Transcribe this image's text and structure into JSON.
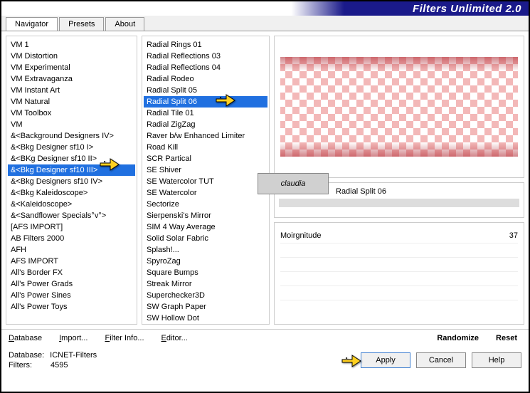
{
  "app_title": "Filters Unlimited 2.0",
  "tabs": [
    "Navigator",
    "Presets",
    "About"
  ],
  "active_tab": 0,
  "left_list": [
    "VM 1",
    "VM Distortion",
    "VM Experimental",
    "VM Extravaganza",
    "VM Instant Art",
    "VM Natural",
    "VM Toolbox",
    "VM",
    "&<Background Designers IV>",
    "&<Bkg Designer sf10 I>",
    "&<BKg Designer sf10 II>",
    "&<Bkg Designer sf10 III>",
    "&<Bkg Designers sf10 IV>",
    "&<Bkg Kaleidoscope>",
    "&<Kaleidoscope>",
    "&<Sandflower Specials°v°>",
    "[AFS IMPORT]",
    "AB Filters 2000",
    "AFH",
    "AFS IMPORT",
    "All's Border FX",
    "All's Power Grads",
    "All's Power Sines",
    "All's Power Toys"
  ],
  "left_selected": 11,
  "middle_list": [
    "Radial  Rings 01",
    "Radial Reflections 03",
    "Radial Reflections 04",
    "Radial Rodeo",
    "Radial Split 05",
    "Radial Split 06",
    "Radial Tile 01",
    "Radial ZigZag",
    "Raver b/w Enhanced Limiter",
    "Road Kill",
    "SCR  Partical",
    "SE Shiver",
    "SE Watercolor TUT",
    "SE Watercolor",
    "Sectorize",
    "Sierpenski's Mirror",
    "SIM 4 Way Average",
    "Solid Solar Fabric",
    "Splash!...",
    "SpyroZag",
    "Square Bumps",
    "Streak Mirror",
    "Superchecker3D",
    "SW Graph Paper",
    "SW Hollow Dot"
  ],
  "middle_selected": 5,
  "filter_name": "Radial Split 06",
  "params": [
    {
      "name": "Moirgnitude",
      "value": "37"
    }
  ],
  "footer_links": {
    "database": "Database",
    "import": "Import...",
    "filter_info": "Filter Info...",
    "editor": "Editor...",
    "randomize": "Randomize",
    "reset": "Reset"
  },
  "status": {
    "db_label": "Database:",
    "db_value": "ICNET-Filters",
    "filters_label": "Filters:",
    "filters_value": "4595"
  },
  "buttons": {
    "apply": "Apply",
    "cancel": "Cancel",
    "help": "Help"
  },
  "watermark": "claudia"
}
